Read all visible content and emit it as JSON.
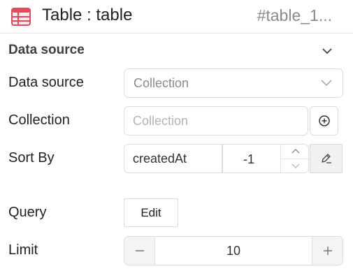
{
  "header": {
    "title": "Table : table",
    "element_id": "#table_1...",
    "icon": "table-icon",
    "accent_color": "#e8485a"
  },
  "section": {
    "title": "Data source",
    "toggle_icon": "chevron-down-icon"
  },
  "fields": {
    "data_source": {
      "label": "Data source",
      "value": "Collection"
    },
    "collection": {
      "label": "Collection",
      "placeholder": "Collection",
      "add_icon": "plus-circle-icon"
    },
    "sort_by": {
      "label": "Sort By",
      "field": "createdAt",
      "order": "-1",
      "edit_icon": "pencil-icon"
    },
    "query": {
      "label": "Query",
      "button": "Edit"
    },
    "limit": {
      "label": "Limit",
      "value": "10",
      "minus": "−",
      "plus": "+"
    }
  }
}
